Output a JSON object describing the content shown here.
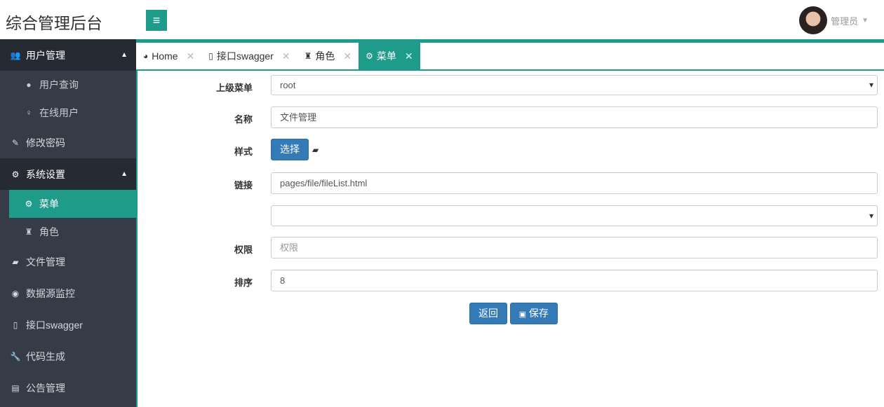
{
  "header": {
    "title": "综合管理后台",
    "menu_icon": "≡",
    "user": "管理员"
  },
  "sidebar": {
    "items": [
      {
        "label": "用户管理",
        "icon": "users-icon"
      },
      {
        "label": "用户查询",
        "icon": "user-icon"
      },
      {
        "label": "在线用户",
        "icon": "male-icon"
      },
      {
        "label": "修改密码",
        "icon": "edit-icon"
      },
      {
        "label": "系统设置",
        "icon": "gears-icon"
      },
      {
        "label": "菜单",
        "icon": "gear-icon"
      },
      {
        "label": "角色",
        "icon": "user-secret-icon"
      },
      {
        "label": "文件管理",
        "icon": "folder-open-icon"
      },
      {
        "label": "数据源监控",
        "icon": "eye-icon"
      },
      {
        "label": "接口swagger",
        "icon": "file-pdf-icon"
      },
      {
        "label": "代码生成",
        "icon": "wrench-icon"
      },
      {
        "label": "公告管理",
        "icon": "book-icon"
      }
    ]
  },
  "tabs": [
    {
      "label": "Home"
    },
    {
      "label": "接口swagger"
    },
    {
      "label": "角色"
    },
    {
      "label": "菜单"
    }
  ],
  "form": {
    "parent_label": "上级菜单",
    "parent_value": "root",
    "name_label": "名称",
    "name_value": "文件管理",
    "style_label": "样式",
    "style_button": "选择",
    "link_label": "链接",
    "link_value": "pages/file/fileList.html",
    "perm_label": "权限",
    "perm_placeholder": "权限",
    "sort_label": "排序",
    "sort_value": "8",
    "back_button": "返回",
    "save_button": "保存"
  }
}
